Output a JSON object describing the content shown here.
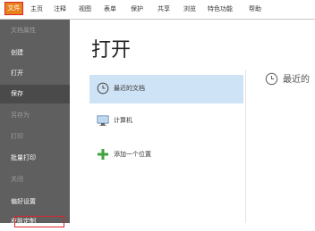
{
  "ribbon": {
    "file_tab": "文件",
    "tabs": [
      "主页",
      "注释",
      "视图",
      "表单",
      "保护",
      "共享",
      "浏览",
      "特色功能",
      "帮助"
    ]
  },
  "sidebar": {
    "items": [
      {
        "label": "文档属性",
        "state": "dim"
      },
      {
        "label": "创建",
        "state": "normal"
      },
      {
        "label": "打开",
        "state": "normal"
      },
      {
        "label": "保存",
        "state": "selected"
      },
      {
        "label": "另存为",
        "state": "dim"
      },
      {
        "label": "打印",
        "state": "dim"
      },
      {
        "label": "批量打印",
        "state": "normal"
      },
      {
        "label": "关闭",
        "state": "dim"
      },
      {
        "label": "偏好设置",
        "state": "normal"
      },
      {
        "label": "皮肤定制",
        "state": "normal"
      }
    ]
  },
  "main": {
    "title": "打开",
    "locations": [
      {
        "label": "最近的文档",
        "icon": "clock-icon",
        "selected": true
      },
      {
        "label": "计算机",
        "icon": "computer-icon",
        "selected": false
      },
      {
        "label": "添加一个位置",
        "icon": "plus-icon",
        "selected": false
      }
    ],
    "right_heading": "最近的"
  },
  "colors": {
    "file_tab_bg": "#e8821b",
    "highlight_border": "#e0242c",
    "sidebar_bg": "#5f5f5f",
    "selected_location": "#cfe3f6",
    "plus_icon": "#3fa33f"
  }
}
